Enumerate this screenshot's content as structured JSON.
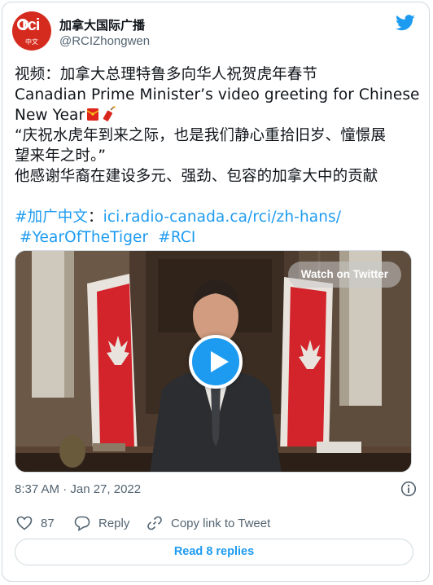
{
  "account": {
    "display_name": "加拿大国际广播",
    "handle": "@RCIZhongwen",
    "avatar_text": "rci",
    "avatar_subtext": "中文",
    "brand_color": "#d52b1e"
  },
  "tweet": {
    "line1": "视频：加拿大总理特鲁多向华人祝贺虎年春节",
    "line2": "Canadian Prime Minister’s video greeting for Chinese",
    "line3": "New Year",
    "line4": "“庆祝水虎年到来之际，也是我们静心重拾旧岁、憧憬展",
    "line5": "望来年之时。”",
    "line6": "他感谢华裔在建设多元、强劲、包容的加拿大中的贡献",
    "hashtag_cn": "#加广中文",
    "colon": "：",
    "url": "ici.radio-canada.ca/rci/zh-hans/",
    "hashtag_tiger": "#YearOfTheTiger",
    "hashtag_rci": "#RCI",
    "emojis": [
      "red-envelope-emoji",
      "firecracker-emoji"
    ]
  },
  "media": {
    "watch_label": "Watch on Twitter",
    "play_icon": "play-icon"
  },
  "meta": {
    "timestamp": "8:37 AM · Jan 27, 2022"
  },
  "actions": {
    "like_count": "87",
    "reply_label": "Reply",
    "copy_label": "Copy link to Tweet"
  },
  "footer": {
    "read_replies_label": "Read 8 replies"
  },
  "colors": {
    "link": "#1d9bf0",
    "muted": "#536471",
    "border": "#cfd9de"
  }
}
